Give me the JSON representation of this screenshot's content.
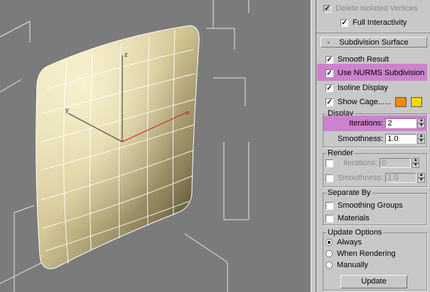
{
  "viewport": {
    "name": "Perspective viewport",
    "axis_labels": {
      "z": "z",
      "y": "y",
      "x": "x"
    }
  },
  "panel": {
    "delete_isolated": {
      "label": "Delete Isolated Vertices",
      "checked": true,
      "enabled": false
    },
    "full_interactivity": {
      "label": "Full Interactivity",
      "checked": true
    },
    "rollout": {
      "toggle": "-",
      "title": "Subdivision Surface"
    },
    "smooth_result": {
      "label": "Smooth Result",
      "checked": true
    },
    "use_nurms": {
      "label": "Use NURMS Subdivision",
      "checked": true
    },
    "isoline_display": {
      "label": "Isoline Display",
      "checked": true
    },
    "show_cage": {
      "label": "Show Cage......",
      "checked": true,
      "colors": [
        "#f08c00",
        "#f0d800"
      ]
    },
    "display": {
      "title": "Display",
      "iterations_label": "Iterations:",
      "iterations_value": "2",
      "smoothness_label": "Smoothness:",
      "smoothness_value": "1.0"
    },
    "render": {
      "title": "Render",
      "iterations_label": "Iterations:",
      "iterations_value": "0",
      "smoothness_label": "Smoothness:",
      "smoothness_value": "1.0"
    },
    "separate_by": {
      "title": "Separate By",
      "smoothing_groups": "Smoothing Groups",
      "materials": "Materials"
    },
    "update_options": {
      "title": "Update Options",
      "always": "Always",
      "when_rendering": "When Rendering",
      "manually": "Manually",
      "selected": "Always",
      "update_button": "Update"
    },
    "highlight_color": "#cc82cc"
  }
}
